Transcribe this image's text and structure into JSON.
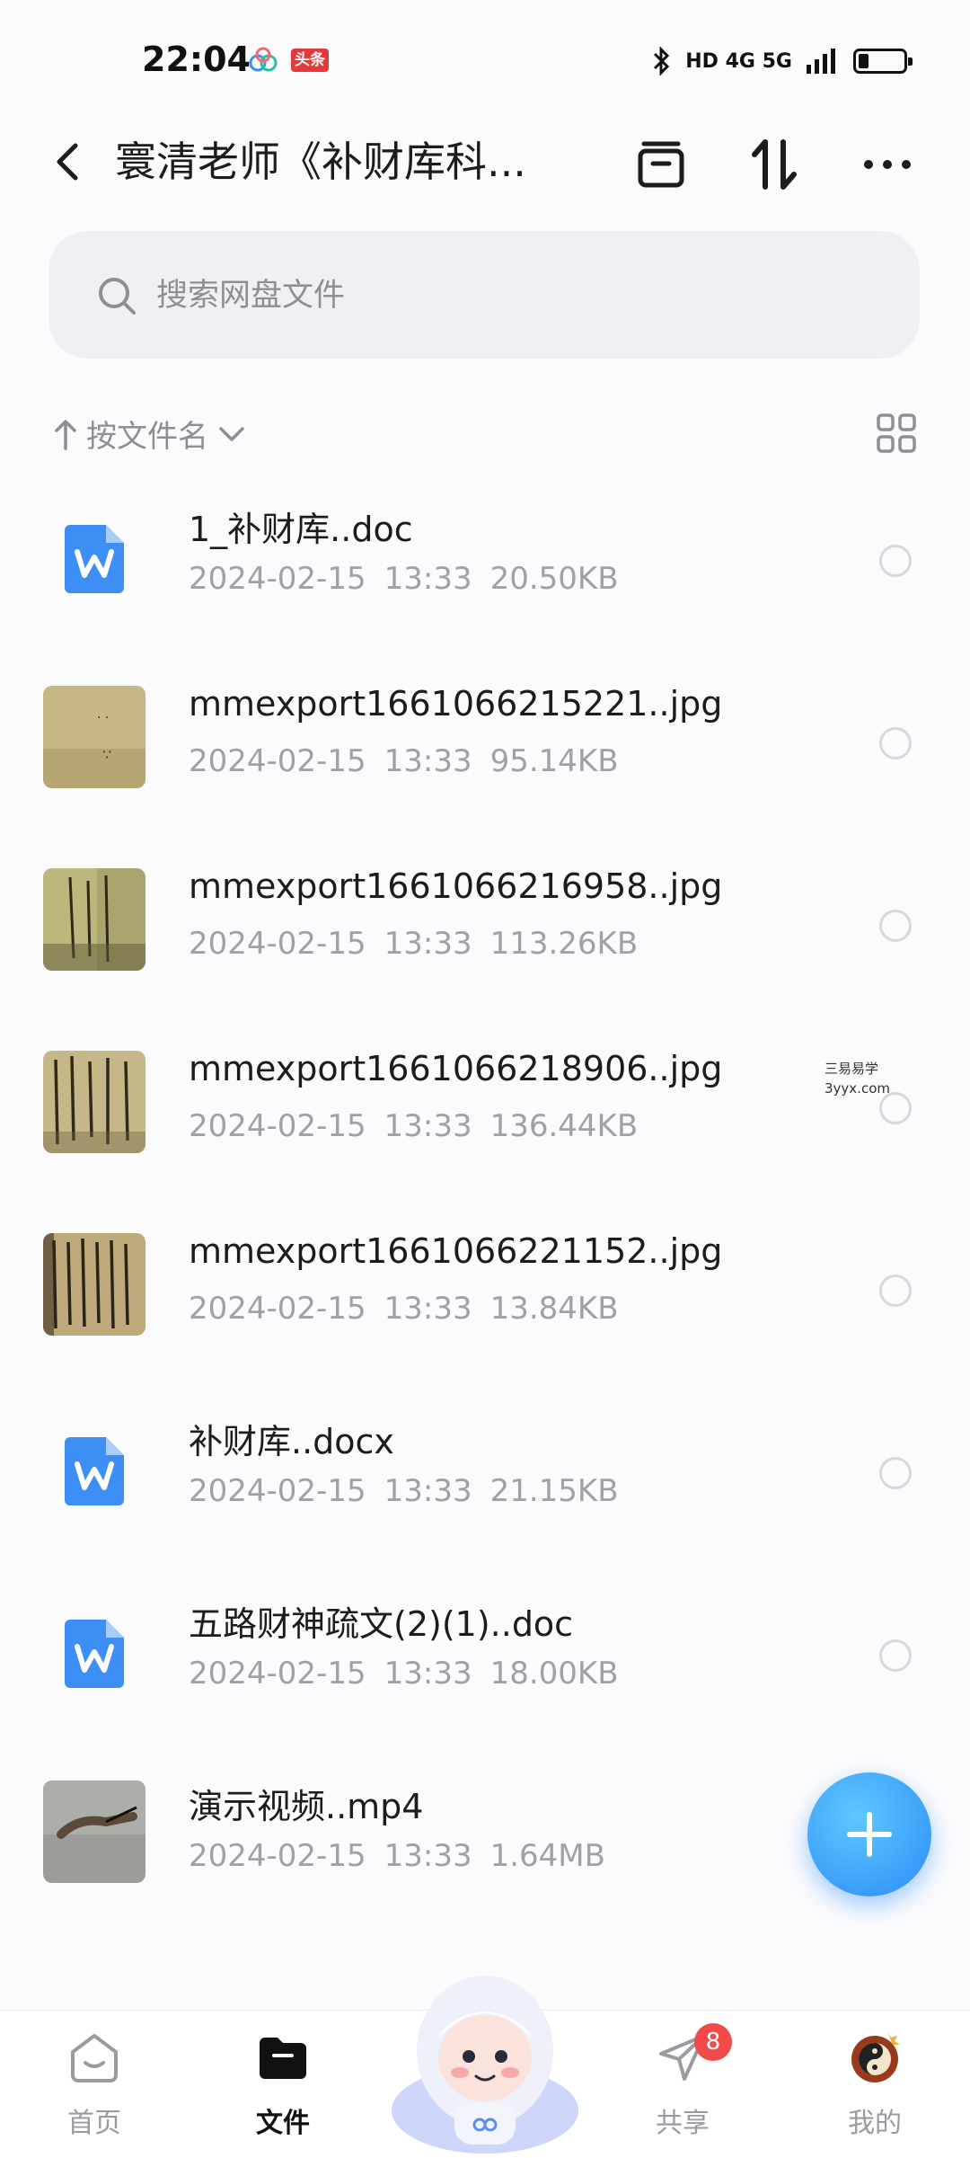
{
  "status_bar": {
    "time": "22:04",
    "app_badge": "头条",
    "network": "HD 4G 5G"
  },
  "header": {
    "title": "寰清老师《补财库科...",
    "icons": [
      "back-icon",
      "archive-icon",
      "sort-arrows-icon",
      "more-icon"
    ]
  },
  "search": {
    "placeholder": "搜索网盘文件"
  },
  "sort": {
    "label": "按文件名"
  },
  "files": [
    {
      "name": "1_补财库..doc",
      "date": "2024-02-15",
      "time": "13:33",
      "size": "20.50KB",
      "type": "word"
    },
    {
      "name": "mmexport1661066215221..jpg",
      "date": "2024-02-15",
      "time": "13:33",
      "size": "95.14KB",
      "type": "image"
    },
    {
      "name": "mmexport1661066216958..jpg",
      "date": "2024-02-15",
      "time": "13:33",
      "size": "113.26KB",
      "type": "image"
    },
    {
      "name": "mmexport1661066218906..jpg",
      "date": "2024-02-15",
      "time": "13:33",
      "size": "136.44KB",
      "type": "image"
    },
    {
      "name": "mmexport1661066221152..jpg",
      "date": "2024-02-15",
      "time": "13:33",
      "size": "13.84KB",
      "type": "image"
    },
    {
      "name": "补财库..docx",
      "date": "2024-02-15",
      "time": "13:33",
      "size": "21.15KB",
      "type": "word"
    },
    {
      "name": "五路财神疏文(2)(1)..doc",
      "date": "2024-02-15",
      "time": "13:33",
      "size": "18.00KB",
      "type": "word"
    },
    {
      "name": "演示视频..mp4",
      "date": "2024-02-15",
      "time": "13:33",
      "size": "1.64MB",
      "type": "video"
    }
  ],
  "watermark": {
    "line1": "三易易学",
    "line2": "3yyx.com"
  },
  "nav": {
    "home": "首页",
    "files": "文件",
    "share": "共享",
    "share_badge": "8",
    "me": "我的"
  },
  "colors": {
    "accent": "#2b8cf7",
    "word_icon": "#3d8ef5",
    "badge": "#f24a4a"
  }
}
